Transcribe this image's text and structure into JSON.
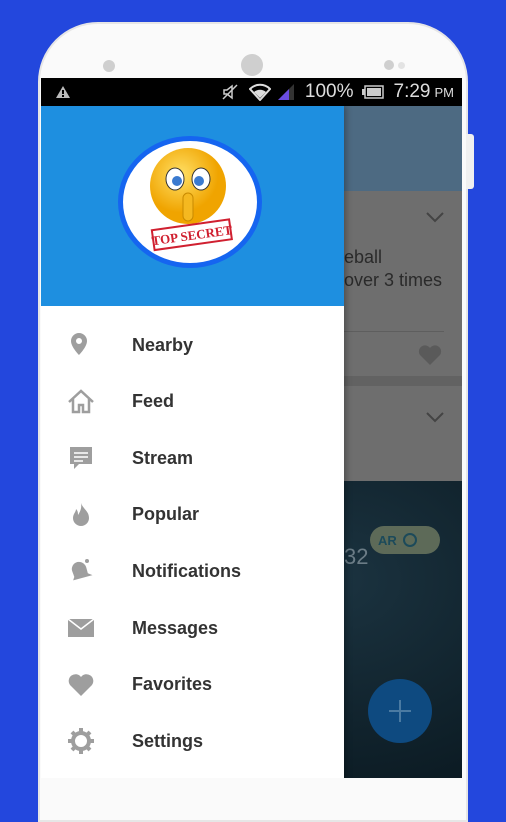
{
  "status_bar": {
    "battery": "100%",
    "time": "7:29",
    "ampm": "PM"
  },
  "header": {
    "stamp_text": "TOP SECRET"
  },
  "menu": [
    {
      "label": "Nearby",
      "icon": "map-pin-icon"
    },
    {
      "label": "Feed",
      "icon": "home-icon"
    },
    {
      "label": "Stream",
      "icon": "chat-bubble-icon"
    },
    {
      "label": "Popular",
      "icon": "flame-icon"
    },
    {
      "label": "Notifications",
      "icon": "bell-icon"
    },
    {
      "label": "Messages",
      "icon": "envelope-icon"
    },
    {
      "label": "Favorites",
      "icon": "heart-icon"
    },
    {
      "label": "Settings",
      "icon": "gear-icon"
    }
  ],
  "background": {
    "post_line1": "eball",
    "post_line2": "over 3 times",
    "counter": "32",
    "ar_label": "AR"
  },
  "colors": {
    "page_bg": "#2347dd",
    "drawer_header": "#1e8fe0",
    "avatar_ring": "#1565f0",
    "icon_gray": "#9e9e9e"
  }
}
